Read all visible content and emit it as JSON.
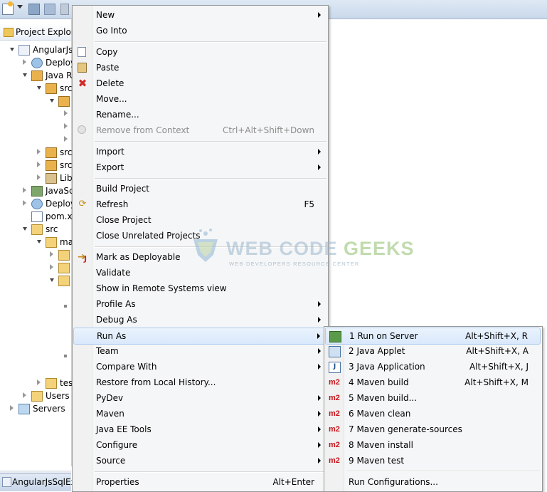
{
  "explorer": {
    "title": "Project Explore",
    "tree": [
      {
        "label": "AngularJs",
        "icon": "project-icon"
      },
      {
        "label": "Deploy",
        "icon": "deployment-descriptor-icon"
      },
      {
        "label": "Java R",
        "icon": "java-resources-icon"
      },
      {
        "label": "src",
        "icon": "source-folder-icon"
      },
      {
        "label": "",
        "icon": "package-icon"
      },
      {
        "label": "src",
        "icon": "source-folder-icon"
      },
      {
        "label": "src",
        "icon": "source-folder-icon"
      },
      {
        "label": "Lib",
        "icon": "libraries-icon"
      },
      {
        "label": "JavaSc",
        "icon": "javascript-resources-icon"
      },
      {
        "label": "Deploy",
        "icon": "deployed-resources-icon"
      },
      {
        "label": "pom.x",
        "icon": "maven-pom-icon"
      },
      {
        "label": "src",
        "icon": "folder-icon"
      },
      {
        "label": "ma",
        "icon": "folder-icon"
      },
      {
        "label": "tes",
        "icon": "folder-icon"
      },
      {
        "label": "Users",
        "icon": "folder-icon"
      },
      {
        "label": "Servers",
        "icon": "folder-icon"
      }
    ]
  },
  "bottom_tab": {
    "label": "AngularJsSqlEx"
  },
  "context_menu": {
    "items": [
      {
        "label": "New",
        "submenu": true
      },
      {
        "label": "Go Into"
      },
      {
        "label": "Copy",
        "icon": "copy-icon"
      },
      {
        "label": "Paste",
        "icon": "paste-icon"
      },
      {
        "label": "Delete",
        "icon": "delete-icon"
      },
      {
        "label": "Move..."
      },
      {
        "label": "Rename..."
      },
      {
        "label": "Remove from Context",
        "shortcut": "Ctrl+Alt+Shift+Down",
        "disabled": true
      },
      {
        "label": "Import",
        "submenu": true
      },
      {
        "label": "Export",
        "submenu": true
      },
      {
        "label": "Build Project"
      },
      {
        "label": "Refresh",
        "shortcut": "F5"
      },
      {
        "label": "Close Project"
      },
      {
        "label": "Close Unrelated Projects"
      },
      {
        "label": "Mark as Deployable"
      },
      {
        "label": "Validate"
      },
      {
        "label": "Show in Remote Systems view"
      },
      {
        "label": "Profile As",
        "submenu": true
      },
      {
        "label": "Debug As",
        "submenu": true
      },
      {
        "label": "Run As",
        "submenu": true,
        "highlighted": true
      },
      {
        "label": "Team",
        "submenu": true
      },
      {
        "label": "Compare With",
        "submenu": true
      },
      {
        "label": "Restore from Local History..."
      },
      {
        "label": "PyDev",
        "submenu": true
      },
      {
        "label": "Maven",
        "submenu": true
      },
      {
        "label": "Java EE Tools",
        "submenu": true
      },
      {
        "label": "Configure",
        "submenu": true
      },
      {
        "label": "Source",
        "submenu": true
      },
      {
        "label": "Properties",
        "shortcut": "Alt+Enter"
      }
    ]
  },
  "run_as_submenu": {
    "items": [
      {
        "label": "1 Run on Server",
        "shortcut": "Alt+Shift+X, R",
        "icon": "run-on-server-icon",
        "highlighted": true
      },
      {
        "label": "2 Java Applet",
        "shortcut": "Alt+Shift+X, A",
        "icon": "java-applet-icon"
      },
      {
        "label": "3 Java Application",
        "shortcut": "Alt+Shift+X, J",
        "icon": "java-application-icon"
      },
      {
        "label": "4 Maven build",
        "shortcut": "Alt+Shift+X, M",
        "icon": "maven-icon"
      },
      {
        "label": "5 Maven build...",
        "icon": "maven-icon"
      },
      {
        "label": "6 Maven clean",
        "icon": "maven-icon"
      },
      {
        "label": "7 Maven generate-sources",
        "icon": "maven-icon"
      },
      {
        "label": "8 Maven install",
        "icon": "maven-icon"
      },
      {
        "label": "9 Maven test",
        "icon": "maven-icon"
      },
      {
        "label": "Run Configurations..."
      }
    ],
    "maven_icon_text": "m2",
    "java_app_icon_text": "J"
  },
  "watermark": {
    "title_part1": "WEB CODE ",
    "title_part2": "GEEKS",
    "subtitle": "WEB DEVELOPERS RESOURCE CENTER"
  }
}
